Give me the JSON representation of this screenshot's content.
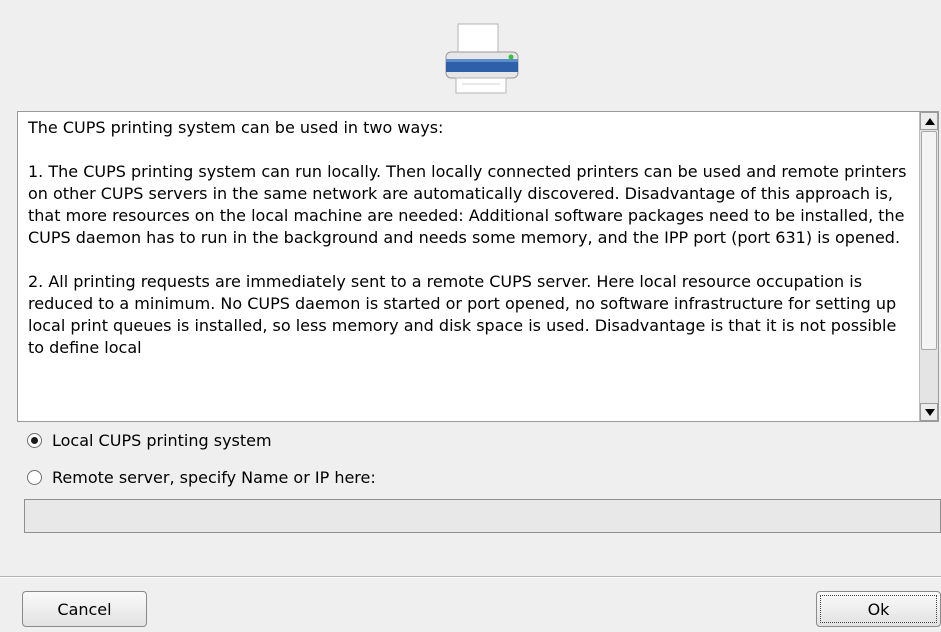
{
  "dialog": {
    "paragraphs": [
      "The CUPS printing system can be used in two ways:",
      "1. The CUPS printing system can run locally. Then locally connected printers can be used and remote printers on other CUPS servers in the same network are automatically discovered. Disadvantage of this approach is, that more resources on the local machine are needed: Additional software packages need to be installed, the CUPS daemon has to run in the background and needs some memory, and the IPP port (port 631) is opened.",
      "2. All printing requests are immediately sent to a remote CUPS server. Here local resource occupation is reduced to a minimum. No CUPS daemon is started or port opened, no software infrastructure for setting up local print queues is installed, so less memory and disk space is used. Disadvantage is that it is not possible to define local"
    ],
    "options": {
      "local_label": "Local CUPS printing system",
      "local_selected": true,
      "remote_label": "Remote server, specify Name or IP here:",
      "remote_selected": false
    },
    "server_input": {
      "value": "",
      "placeholder": ""
    },
    "buttons": {
      "cancel": "Cancel",
      "ok": "Ok"
    },
    "icons": {
      "header": "printer-icon",
      "scroll_up": "arrow-up-icon",
      "scroll_down": "arrow-down-icon"
    }
  }
}
